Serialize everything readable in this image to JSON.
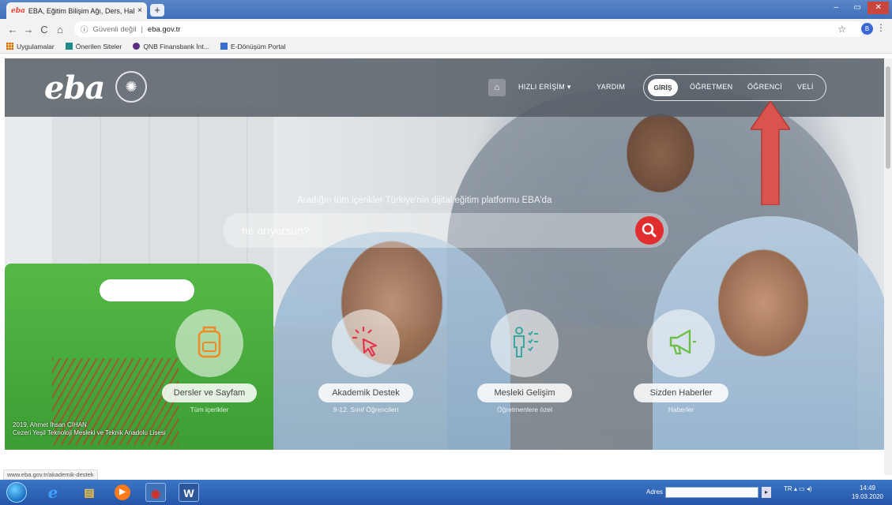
{
  "browser": {
    "tab_title": "EBA, Eğitim Bilişim Ağı, Ders, Hal",
    "tab_close": "×",
    "tab_favicon_text": "eba",
    "new_tab": "+",
    "security_label": "Güvenli değil",
    "url": "eba.gov.tr",
    "profile_initial": "B",
    "back": "←",
    "forward": "→",
    "reload": "C",
    "home": "⌂",
    "star": "☆",
    "menu": "⋮",
    "window_controls": [
      "–",
      "▭",
      "✕"
    ]
  },
  "bookmarks": [
    {
      "label": "Uygulamalar",
      "icon": "apps-grid-icon",
      "color": "#e8a23a"
    },
    {
      "label": "Önerilen Siteler",
      "icon": "bing-icon",
      "color": "#1f8a8a"
    },
    {
      "label": "QNB Finansbank İnt...",
      "icon": "qnb-icon",
      "color": "#5a2d82"
    },
    {
      "label": "E-Dönüşüm Portal",
      "icon": "eba-icon",
      "color": "#3a6fd0"
    }
  ],
  "site": {
    "logo": "eba",
    "nav": {
      "home": "⌂",
      "hizli_erisim": "HIZLI ERİŞİM",
      "yardim": "YARDIM",
      "giris": "GİRİŞ",
      "ogretmen": "ÖĞRETMEN",
      "ogrenci": "ÖĞRENCİ",
      "veli": "VELİ"
    },
    "tagline": "Aradığın tüm içerikler Türkiye'nin dijital eğitim platformu EBA'da",
    "search_placeholder": "ne arıyorsun?",
    "features": [
      {
        "label": "Dersler ve Sayfam",
        "sub": "Tüm içerikler",
        "icon": "backpack-icon"
      },
      {
        "label": "Akademik Destek",
        "sub": "9-12. Sınıf Öğrencileri",
        "icon": "cursor-click-icon"
      },
      {
        "label": "Mesleki Gelişim",
        "sub": "Öğretmenlere özel",
        "icon": "person-checklist-icon"
      },
      {
        "label": "Sizden Haberler",
        "sub": "Haberler",
        "icon": "megaphone-icon"
      }
    ],
    "photo_credit_line1": "2019, Ahmet İhsan CİHAN",
    "photo_credit_line2": "Cezeri Yeşil Teknoloji Mesleki ve Teknik Anadolu Lisesi"
  },
  "status_url": "www.eba.gov.tr/akademik-destek",
  "taskbar": {
    "adres_label": "Adres",
    "tray_lang": "TR",
    "time": "14:49",
    "date": "19.03.2020",
    "apps": [
      {
        "name": "ie-icon",
        "glyph": "e",
        "color": "#1e90ff"
      },
      {
        "name": "explorer-folder-icon",
        "glyph": "▤",
        "color": "#e8b230"
      },
      {
        "name": "media-player-icon",
        "glyph": "▶",
        "color": "#ff7a1a"
      },
      {
        "name": "chrome-icon",
        "glyph": "◉",
        "color": "#d93025"
      },
      {
        "name": "word-icon",
        "glyph": "W",
        "color": "#2b579a"
      }
    ]
  },
  "colors": {
    "accent_red": "#e22d2f",
    "nav_bg": "#525a62",
    "annotation_arrow": "#d9534f"
  }
}
